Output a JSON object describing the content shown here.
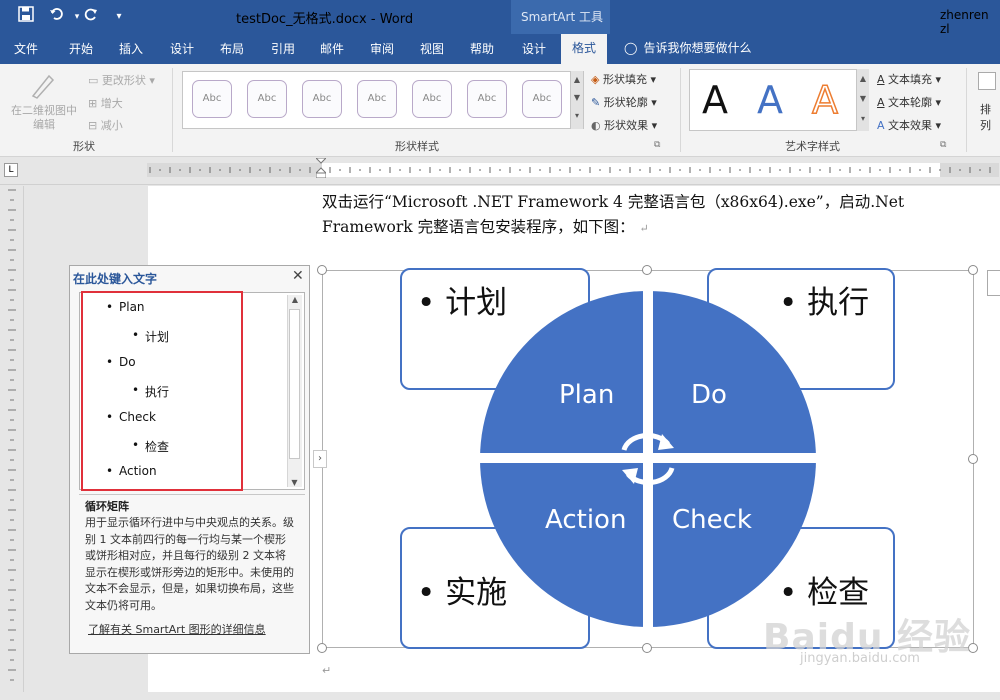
{
  "quick_access": {
    "save_icon": "save-icon",
    "undo_icon": "undo-icon",
    "redo_icon": "redo-icon",
    "customize_icon": "customize-icon"
  },
  "window": {
    "title": "testDoc_无格式.docx  -  Word",
    "context_tool": "SmartArt 工具",
    "user": "zhenren zl"
  },
  "tabs": [
    "文件",
    "开始",
    "插入",
    "设计",
    "布局",
    "引用",
    "邮件",
    "审阅",
    "视图",
    "帮助",
    "设计",
    "格式"
  ],
  "active_tab": "格式",
  "tell_me": "告诉我你想要做什么",
  "ribbon": {
    "shape_group": {
      "label": "形状",
      "edit_2d": "在二维视图中编辑",
      "change_shape": "更改形状",
      "grow": "增大",
      "shrink": "减小"
    },
    "shape_styles": {
      "label": "形状样式",
      "style_box_text": "Abc",
      "fill": "形状填充",
      "outline": "形状轮廓",
      "effects": "形状效果"
    },
    "wordart": {
      "label": "艺术字样式",
      "letter": "A",
      "text_fill": "文本填充",
      "text_outline": "文本轮廓",
      "text_effects": "文本效果"
    },
    "arrange_partial": "排列"
  },
  "document": {
    "paragraph": "双击运行“Microsoft .NET Framework 4 完整语言包（x86x64).exe”，启动.Net Framework 完整语言包安装程序，如下图：",
    "para_mark": "↵"
  },
  "text_pane": {
    "title": "在此处键入文字",
    "items": [
      {
        "text": "Plan",
        "level": 1
      },
      {
        "text": "计划",
        "level": 2
      },
      {
        "text": "Do",
        "level": 1
      },
      {
        "text": "执行",
        "level": 2
      },
      {
        "text": "Check",
        "level": 1
      },
      {
        "text": "检查",
        "level": 2
      },
      {
        "text": "Action",
        "level": 1
      }
    ],
    "desc_title": "循环矩阵",
    "desc": "用于显示循环行进中与中央观点的关系。级别 1 文本前四行的每一行均与某一个楔形或饼形相对应，并且每行的级别 2 文本将显示在楔形或饼形旁边的矩形中。未使用的文本不会显示，但是，如果切换布局，这些文本仍将可用。",
    "learn_more": "了解有关 SmartArt 图形的详细信息"
  },
  "smartart": {
    "quadrants": [
      "Plan",
      "Do",
      "Action",
      "Check"
    ],
    "boxes": {
      "top_left": "计划",
      "top_right": "执行",
      "bottom_left": "实施",
      "bottom_right": "检查"
    },
    "fill_color": "#4472c4"
  },
  "watermark": {
    "main": "Baidu 经验",
    "sub": "jingyan.baidu.com"
  },
  "colors": {
    "accent": "#2b579a",
    "smartart": "#4472c4",
    "highlight": "#e0303a"
  }
}
